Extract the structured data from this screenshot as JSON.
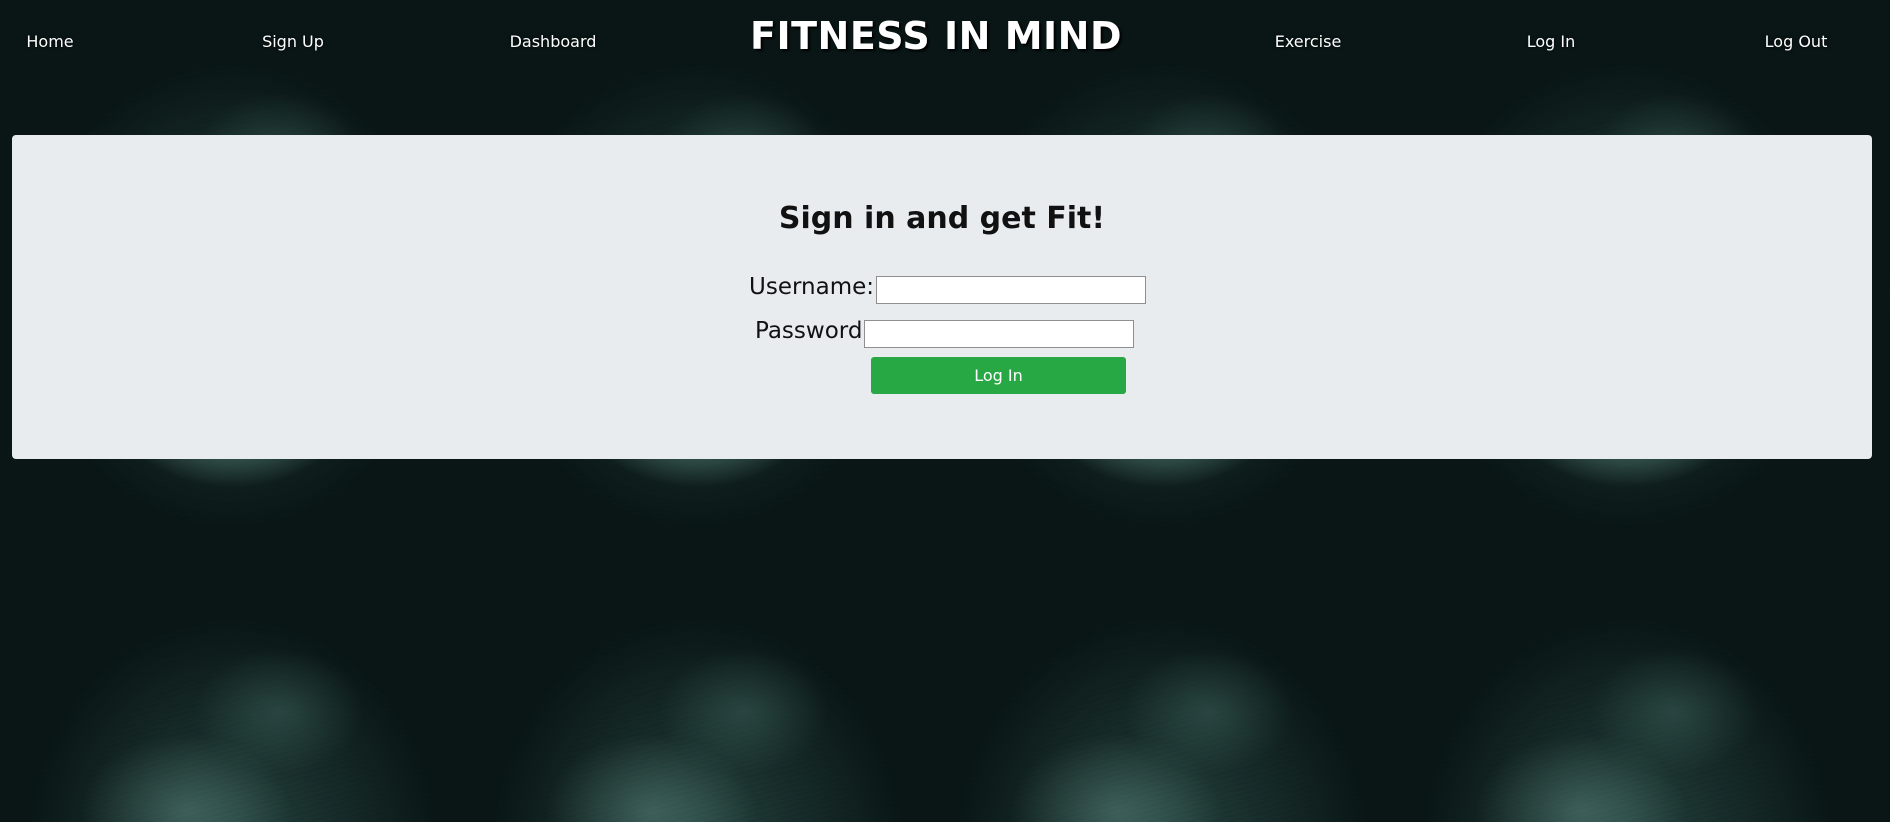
{
  "nav": {
    "brand": "FITNESS IN MIND",
    "links": [
      {
        "label": "Home"
      },
      {
        "label": "Sign Up"
      },
      {
        "label": "Dashboard"
      },
      {
        "label": "Exercise"
      },
      {
        "label": "Log In"
      },
      {
        "label": "Log Out"
      }
    ]
  },
  "login": {
    "heading_prefix": "Sign in and get ",
    "heading_emphasis": "Fit!",
    "username_label": "Username:",
    "username_value": "",
    "password_label": "Password:",
    "password_value": "",
    "submit_label": "Log In"
  },
  "colors": {
    "panel_bg": "#e8ecef",
    "button_bg": "#28a745",
    "nav_text": "#ffffff"
  }
}
